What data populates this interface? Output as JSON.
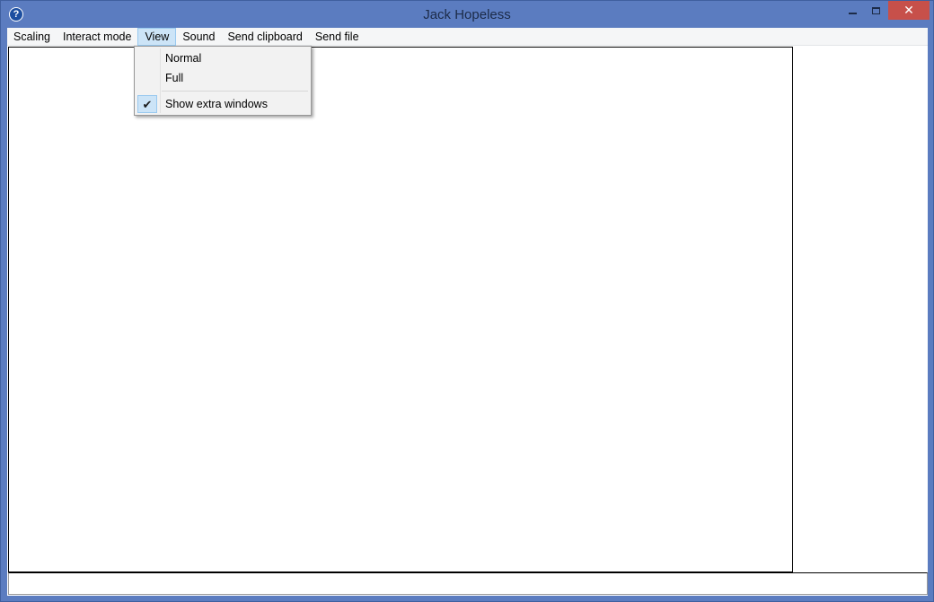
{
  "window": {
    "title": "Jack Hopeless",
    "help_glyph": "?",
    "close_glyph": "✕"
  },
  "menubar": {
    "items": [
      {
        "label": "Scaling"
      },
      {
        "label": "Interact mode"
      },
      {
        "label": "View"
      },
      {
        "label": "Sound"
      },
      {
        "label": "Send clipboard"
      },
      {
        "label": "Send file"
      }
    ]
  },
  "view_menu": {
    "items": [
      {
        "label": "Normal",
        "checked": false
      },
      {
        "label": "Full",
        "checked": false
      },
      {
        "label": "Show extra windows",
        "checked": true
      }
    ],
    "check_glyph": "✔"
  },
  "colors": {
    "frame": "#5b7cc0",
    "menu_highlight": "#cce4f7",
    "close_button": "#c7504a"
  }
}
